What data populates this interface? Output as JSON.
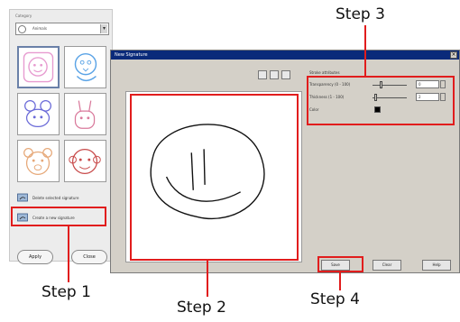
{
  "left_panel": {
    "category_label": "Category",
    "category_value": "Animals",
    "action_delete": "Delete selected signature",
    "action_create": "Create a new signature",
    "apply_label": "Apply",
    "close_label": "Close"
  },
  "dialog": {
    "title": "New Signature",
    "stroke_title": "Stroke attributes",
    "transparency_label": "Transparency (0 - 100)",
    "transparency_value": "0",
    "thickness_label": "Thickness (1 - 100)",
    "thickness_value": "2",
    "color_label": "Color",
    "stroke_color": "#000000",
    "save_label": "Save",
    "clear_label": "Clear",
    "help_label": "Help"
  },
  "annotations": {
    "step1": "Step 1",
    "step2": "Step 2",
    "step3": "Step 3",
    "step4": "Step 4",
    "highlight_color": "#e11d1d"
  }
}
